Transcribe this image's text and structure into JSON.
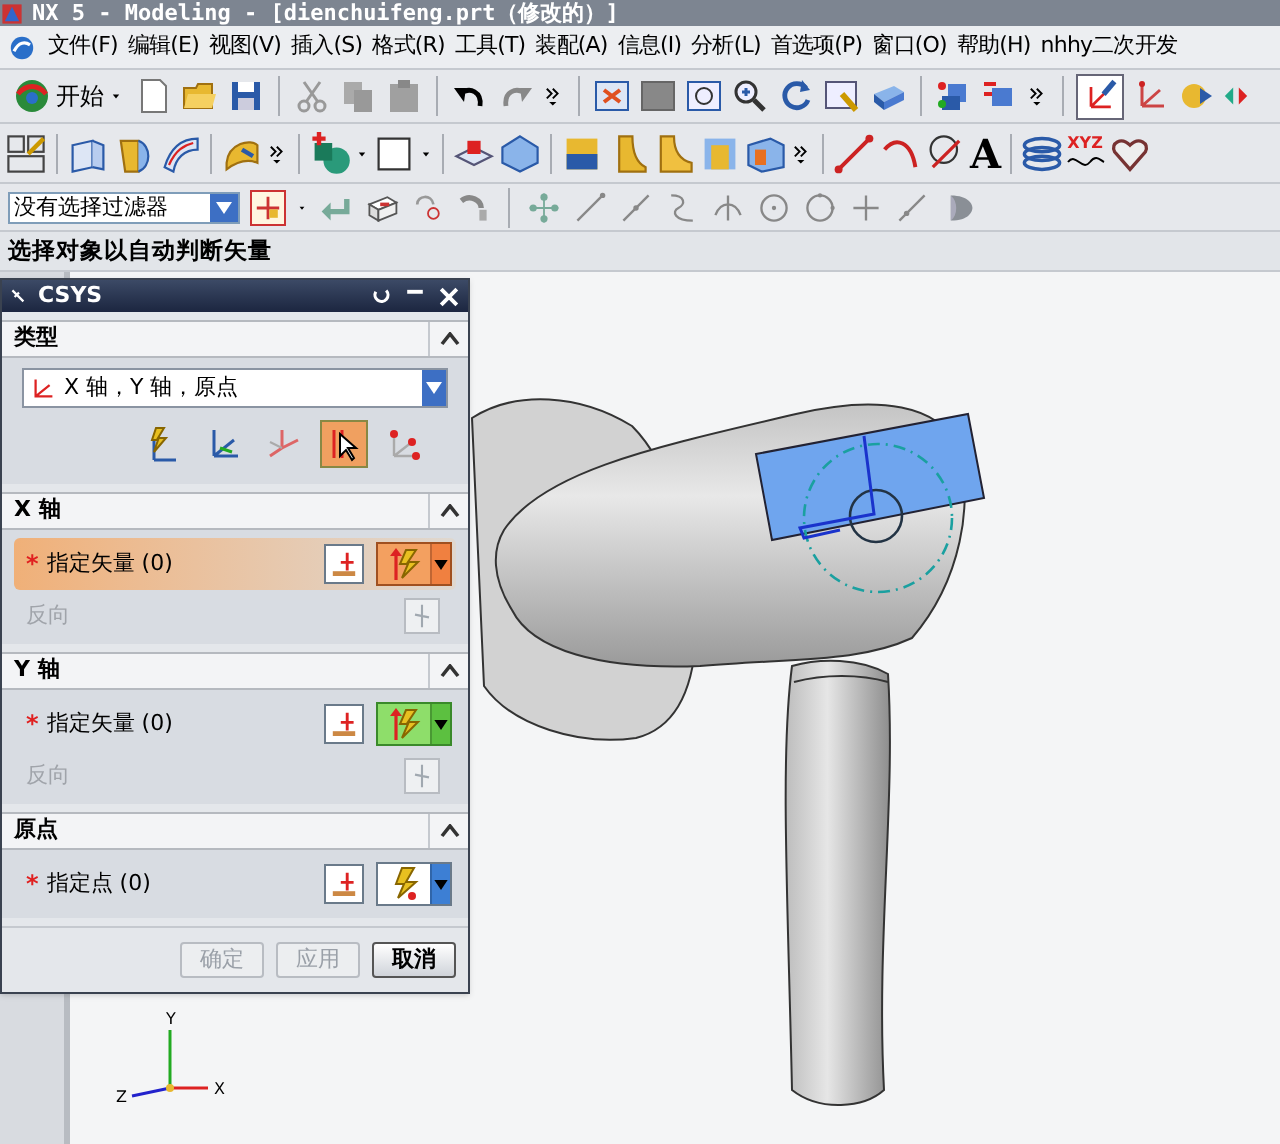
{
  "window": {
    "title": "NX 5 - Modeling - [dienchuifeng.prt（修改的）]"
  },
  "menu_bar": {
    "items": [
      "文件(F)",
      "编辑(E)",
      "视图(V)",
      "插入(S)",
      "格式(R)",
      "工具(T)",
      "装配(A)",
      "信息(I)",
      "分析(L)",
      "首选项(P)",
      "窗口(O)",
      "帮助(H)",
      "nhhy二次开发"
    ]
  },
  "standard_toolbar": {
    "start_button": "开始"
  },
  "curve_toolbar": {
    "xyz_glyph": "XYZ",
    "text_glyph": "A"
  },
  "selection_bar": {
    "filter": "没有选择过滤器"
  },
  "prompt": "选择对象以自动判断矢量",
  "csys_dialog": {
    "title": "CSYS",
    "type_section": {
      "header": "类型",
      "expanded": true,
      "value": "X 轴，Y 轴，原点",
      "options": [
        {
          "selected": false
        },
        {
          "selected": false
        },
        {
          "selected": false
        },
        {
          "selected": true
        },
        {
          "selected": false
        }
      ]
    },
    "sections": [
      {
        "header": "X 轴",
        "expanded": true,
        "rows": [
          {
            "kind": "vector",
            "marker": "*",
            "label": "指定矢量 (0)",
            "active": true
          },
          {
            "kind": "reverse",
            "label": "反向",
            "disabled": true
          }
        ]
      },
      {
        "header": "Y 轴",
        "expanded": true,
        "rows": [
          {
            "kind": "vector",
            "marker": "*",
            "label": "指定矢量 (0)",
            "active": false
          },
          {
            "kind": "reverse",
            "label": "反向",
            "disabled": true
          }
        ]
      },
      {
        "header": "原点",
        "expanded": true,
        "rows": [
          {
            "kind": "point",
            "marker": "*",
            "label": "指定点 (0)",
            "active": false
          }
        ]
      }
    ],
    "buttons": [
      {
        "label": "确定",
        "disabled": true
      },
      {
        "label": "应用",
        "disabled": true
      },
      {
        "label": "取消",
        "disabled": false
      }
    ]
  },
  "triad": {
    "axes": [
      "Y",
      "Z",
      "X"
    ]
  }
}
